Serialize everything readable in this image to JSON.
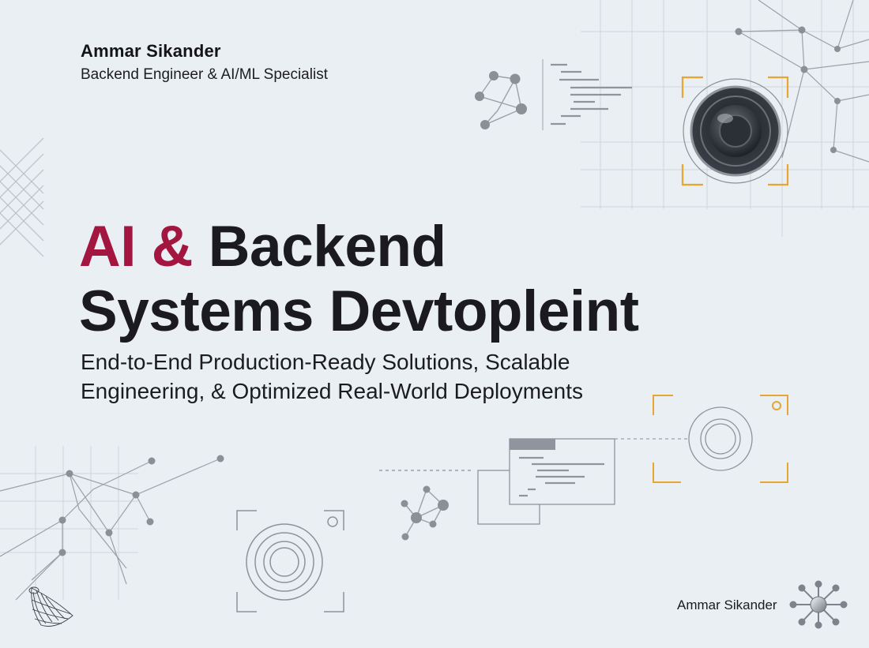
{
  "author": {
    "name": "Ammar Sikander",
    "role": "Backend Engineer & AI/ML Specialist"
  },
  "headline": {
    "accent": "AI &",
    "rest_line1": "Backend",
    "line2": "Systems Devtopleint"
  },
  "subtitle": {
    "line1": "End-to-End Production-Ready Solutions, Scalable",
    "line2": "Engineering, & Optimized Real-World Deployments"
  },
  "footer": {
    "signature": "Ammar Sikander"
  },
  "colors": {
    "background": "#e9eff3",
    "accent": "#a3163f",
    "text": "#1b1b1f",
    "bracket": "#e6a630",
    "line": "#a9b0b8",
    "node": "#8b8f96"
  },
  "icons": [
    "network-graph-icon",
    "code-lines-icon",
    "camera-lens-icon",
    "camera-frame-icon",
    "code-window-icon",
    "wireframe-shape-icon",
    "hub-network-icon"
  ]
}
